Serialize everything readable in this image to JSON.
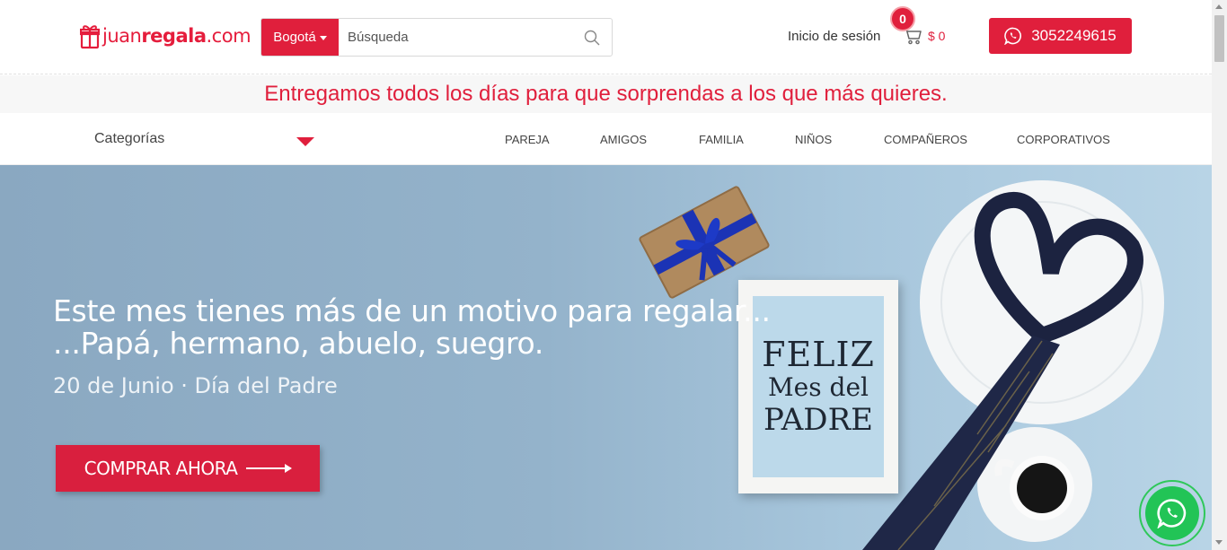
{
  "header": {
    "logo": {
      "prefix": "juan",
      "bold": "regala",
      "suffix": ".com"
    },
    "city_label": "Bogotá",
    "search": {
      "placeholder": "Búsqueda",
      "value": ""
    },
    "login_label": "Inicio de sesión",
    "cart": {
      "count": "0",
      "amount": "$ 0"
    },
    "whatsapp_phone": "3052249615"
  },
  "promo": {
    "text": "Entregamos todos los días para que sorprendas a los que más quieres."
  },
  "nav": {
    "categories_label": "Categorías",
    "links": [
      "PAREJA",
      "AMIGOS",
      "FAMILIA",
      "NIÑOS",
      "COMPAÑEROS",
      "CORPORATIVOS"
    ]
  },
  "hero": {
    "line1": "Este mes tienes más de un motivo para regalar...",
    "line2": "...Papá, hermano, abuelo, suegro.",
    "subtitle": "20 de Junio · Día del Padre",
    "cta_label": "COMPRAR AHORA",
    "frame": {
      "line1": "FELIZ",
      "line2": "Mes del",
      "line3": "PADRE"
    }
  },
  "colors": {
    "brand_red": "#e01f3c",
    "whatsapp_green": "#22c456"
  },
  "icons": [
    "gift-logo-icon",
    "search-icon",
    "cart-icon",
    "whatsapp-icon",
    "chevron-down-icon",
    "arrow-right-icon"
  ]
}
